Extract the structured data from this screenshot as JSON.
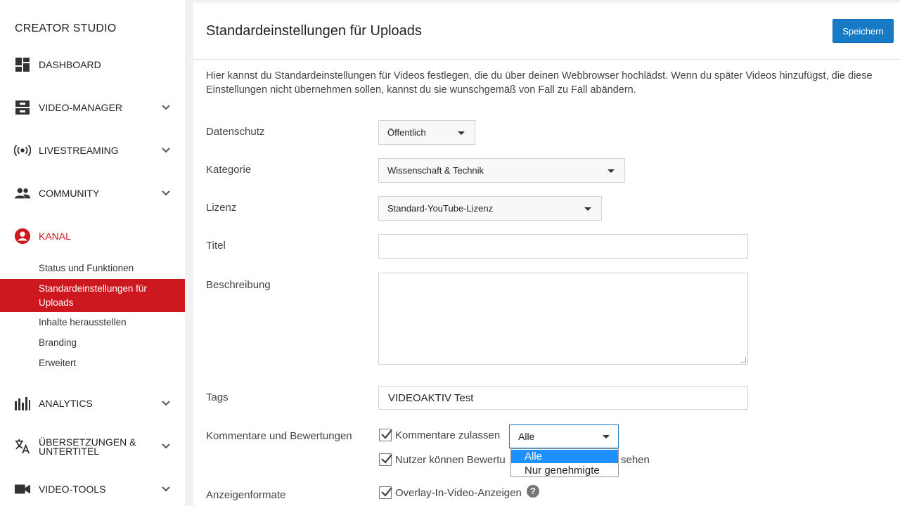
{
  "sidebar": {
    "title": "CREATOR STUDIO",
    "items": [
      {
        "label": "DASHBOARD",
        "icon": "dashboard-icon"
      },
      {
        "label": "VIDEO-MANAGER",
        "icon": "video-manager-icon"
      },
      {
        "label": "LIVESTREAMING",
        "icon": "livestream-icon"
      },
      {
        "label": "COMMUNITY",
        "icon": "community-icon"
      },
      {
        "label": "KANAL",
        "icon": "channel-icon"
      },
      {
        "label": "ANALYTICS",
        "icon": "analytics-icon"
      },
      {
        "label": "ÜBERSETZUNGEN & UNTERTITEL",
        "label_line1": "ÜBERSETZUNGEN &",
        "label_line2": "UNTERTITEL",
        "icon": "translate-icon"
      },
      {
        "label": "VIDEO-TOOLS",
        "icon": "video-tools-icon"
      }
    ],
    "sub_items": [
      "Status und Funktionen",
      "Standardeinstellungen für Uploads",
      "Inhalte herausstellen",
      "Branding",
      "Erweitert"
    ],
    "sub_active_line1": "Standardeinstellungen für",
    "sub_active_line2": "Uploads"
  },
  "header": {
    "title": "Standardeinstellungen für Uploads",
    "save_label": "Speichern"
  },
  "intro": "Hier kannst du Standardeinstellungen für Videos festlegen, die du über deinen Webbrowser hochlädst. Wenn du später Videos hinzufügst, die diese Einstellungen nicht übernehmen sollen, kannst du sie wunschgemäß von Fall zu Fall abändern.",
  "form": {
    "privacy": {
      "label": "Datenschutz",
      "value": "Öffentlich"
    },
    "category": {
      "label": "Kategorie",
      "value": "Wissenschaft & Technik"
    },
    "license": {
      "label": "Lizenz",
      "value": "Standard-YouTube-Lizenz"
    },
    "title": {
      "label": "Titel",
      "value": ""
    },
    "description": {
      "label": "Beschreibung",
      "value": ""
    },
    "tags": {
      "label": "Tags",
      "value": "VIDEOAKTIV Test"
    },
    "comments": {
      "label": "Kommentare und Bewertungen",
      "allow_comments": "Kommentare zulassen",
      "select_value": "Alle",
      "options": [
        "Alle",
        "Nur genehmigte"
      ],
      "ratings_part1": "Nutzer können Bewertu",
      "ratings_part2": "sehen"
    },
    "ads": {
      "label": "Anzeigenformate",
      "overlay": "Overlay-In-Video-Anzeigen",
      "help": "?"
    }
  },
  "colors": {
    "accent": "#cc181e",
    "primary": "#167ac6",
    "highlight": "#1e90ff"
  }
}
